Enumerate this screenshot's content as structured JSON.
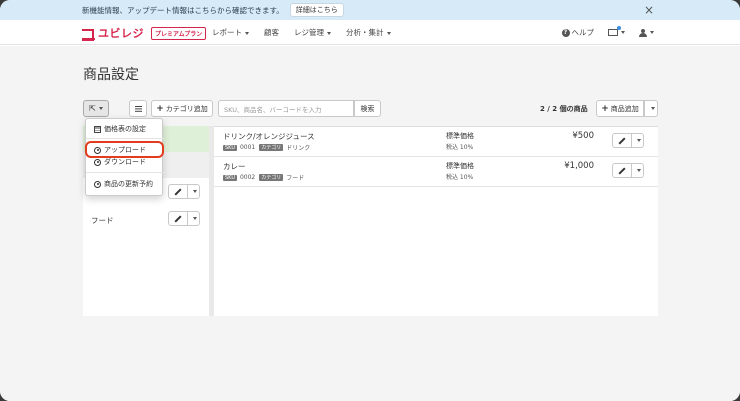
{
  "notice": {
    "text": "新機能情報、アップデート情報はこちらから確認できます。",
    "detail_button": "詳細はこちら",
    "close": "×"
  },
  "nav": {
    "logo_text": "ユビレジ",
    "premium_badge": "プレミアムプラン",
    "menu": [
      {
        "label": "レポート"
      },
      {
        "label": "顧客"
      },
      {
        "label": "レジ管理"
      },
      {
        "label": "分析・集計"
      }
    ],
    "help": "ヘルプ"
  },
  "page": {
    "title": "商品設定"
  },
  "toolbar": {
    "add_category": "カテゴリ追加",
    "search_placeholder": "SKU、商品名、バーコードを入力",
    "search_button": "検索",
    "count": "2 / 2 個の商品",
    "add_product": "商品追加"
  },
  "dropdown": {
    "items": [
      {
        "label": "価格表の設定",
        "icon": "table-icon"
      },
      {
        "label": "アップロード",
        "icon": "upload-icon"
      },
      {
        "label": "ダウンロード",
        "icon": "download-icon"
      },
      {
        "label": "商品の更新予約",
        "icon": "clock-icon"
      }
    ]
  },
  "categories": [
    {
      "name": "フード"
    }
  ],
  "products": [
    {
      "name": "ドリンク/オレンジジュース",
      "sku_tag": "SKU",
      "sku": "0001",
      "category_tag": "カテゴリ",
      "category": "ドリンク",
      "price_label": "標準価格",
      "tax": "税込 10%",
      "price": "¥500"
    },
    {
      "name": "カレー",
      "sku_tag": "SKU",
      "sku": "0002",
      "category_tag": "カテゴリ",
      "category": "フード",
      "price_label": "標準価格",
      "tax": "税込 10%",
      "price": "¥1,000"
    }
  ],
  "colors": {
    "brand": "#d6254d",
    "notice_bg": "#d6eaf8",
    "highlight": "#e23b1e"
  }
}
